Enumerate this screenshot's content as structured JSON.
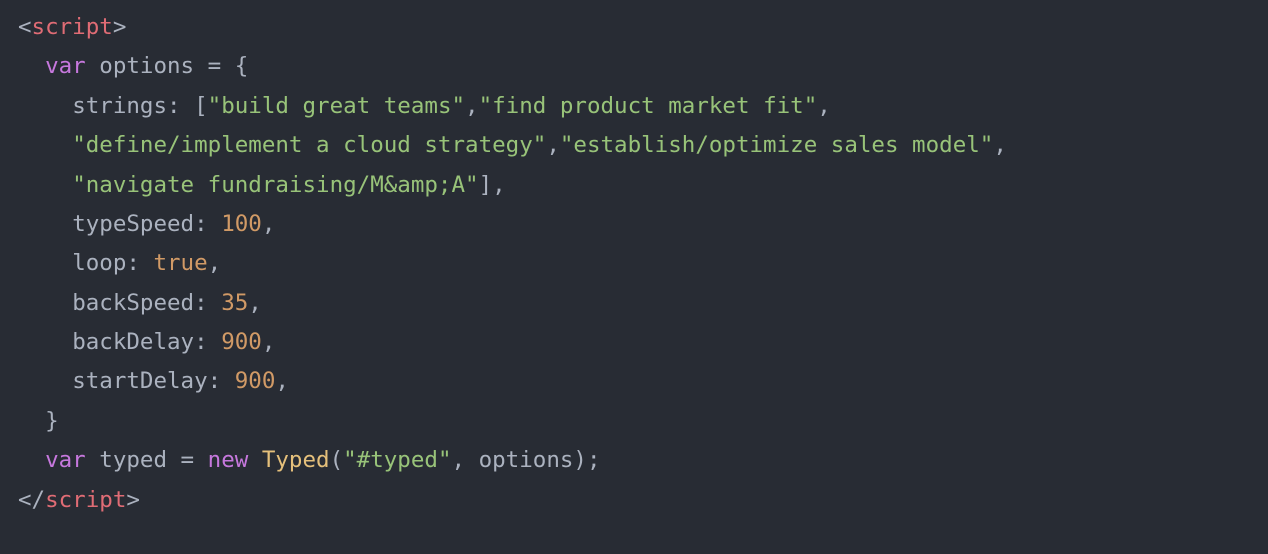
{
  "code": {
    "tag_open_name": "script",
    "tag_close_name": "script",
    "kw_var1": "var",
    "var_options": "options",
    "eq": " = ",
    "brace_open": "{",
    "prop_strings": "strings",
    "colon": ": ",
    "colon2": ": ",
    "colon3": ": ",
    "colon4": ": ",
    "colon5": ": ",
    "colon6": ": ",
    "bracket_open": "[",
    "s1": "\"build great teams\"",
    "comma": ",",
    "s2": "\"find product market fit\"",
    "s3": "\"define/implement a cloud strategy\"",
    "s4": "\"establish/optimize sales model\"",
    "s5": "\"navigate fundraising/M&amp;A\"",
    "bracket_close": "]",
    "prop_typeSpeed": "typeSpeed",
    "val_typeSpeed": "100",
    "prop_loop": "loop",
    "val_loop": "true",
    "prop_backSpeed": "backSpeed",
    "val_backSpeed": "35",
    "prop_backDelay": "backDelay",
    "val_backDelay": "900",
    "prop_startDelay": "startDelay",
    "val_startDelay": "900",
    "brace_close": "}",
    "kw_var2": "var",
    "var_typed": "typed",
    "eq2": " = ",
    "kw_new": "new",
    "class_Typed": "Typed",
    "paren_open": "(",
    "arg_selector": "\"#typed\"",
    "comma_args": ", ",
    "arg_options": "options",
    "paren_close": ")",
    "semicolon": ";",
    "angle_open": "<",
    "angle_close": ">",
    "slash": "/"
  }
}
